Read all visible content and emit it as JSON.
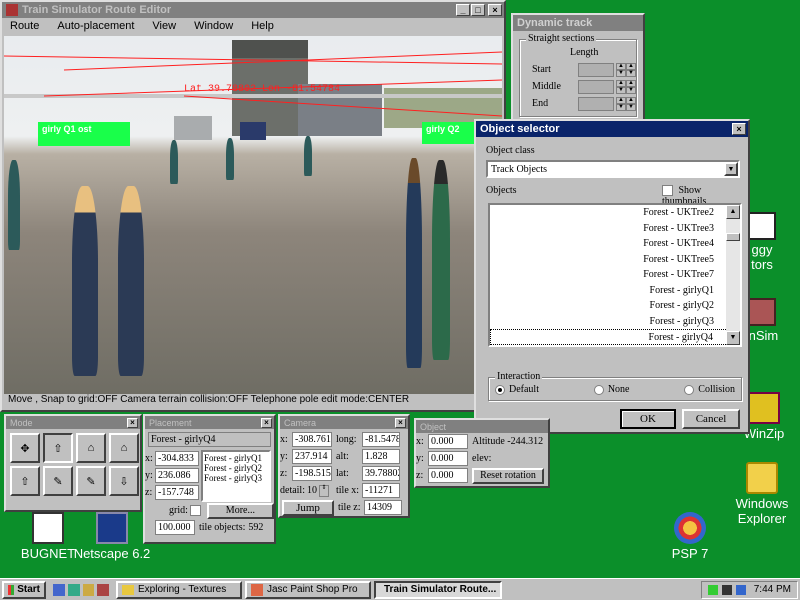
{
  "editor": {
    "title": "Train Simulator Route Editor",
    "menus": [
      "Route",
      "Auto-placement",
      "View",
      "Window",
      "Help"
    ],
    "hud_lat_lon": "Lat 39.78802 Lon -81.54784",
    "signs": [
      "girly Q1 ost",
      "girly Q2"
    ],
    "status": "Move , Snap to grid:OFF Camera terrain collision:OFF Telephone pole edit mode:CENTER"
  },
  "dynamic_track": {
    "title": "Dynamic track",
    "section_title": "Straight sections",
    "length_header": "Length",
    "rows": [
      "Start",
      "Middle",
      "End"
    ]
  },
  "object_selector": {
    "title": "Object selector",
    "class_label": "Object class",
    "class_value": "Track Objects",
    "objects_label": "Objects",
    "show_thumbnails_label": "Show thumbnails",
    "items": [
      "Forest - UKTree2",
      "Forest - UKTree3",
      "Forest - UKTree4",
      "Forest - UKTree5",
      "Forest - UKTree7",
      "Forest - girlyQ1",
      "Forest - girlyQ2",
      "Forest - girlyQ3",
      "Forest - girlyQ4"
    ],
    "selected_item": "Forest - girlyQ4",
    "interaction_label": "Interaction",
    "interaction_options": [
      "Default",
      "None",
      "Collision"
    ],
    "interaction_selected": "Default",
    "ok_label": "OK",
    "cancel_label": "Cancel"
  },
  "mode": {
    "title": "Mode"
  },
  "placement": {
    "title": "Placement",
    "current": "Forest - girlyQ4",
    "x": "-304.833",
    "y": "236.086",
    "z": "-157.748",
    "list": [
      "Forest - girlyQ1",
      "Forest - girlyQ2",
      "Forest - girlyQ3"
    ],
    "grid_label": "grid:",
    "more_label": "More...",
    "grid_value": "100.000",
    "tile_objects_label": "tile objects:",
    "tile_objects_value": "592",
    "x_label": "x:",
    "y_label": "y:",
    "z_label": "z:"
  },
  "camera": {
    "title": "Camera",
    "x": "-308.761",
    "y": "237.914",
    "z": "-198.515",
    "long": "-81.5478",
    "alt": "1.828",
    "lat": "39.78802",
    "tile_x": "-11271",
    "tile_z": "14309",
    "detail": "10",
    "jump_label": "Jump",
    "labels": {
      "x": "x:",
      "y": "y:",
      "z": "z:",
      "long": "long:",
      "alt": "alt:",
      "lat": "lat:",
      "detail": "detail:",
      "tile_x": "tile x:",
      "tile_z": "tile z:"
    }
  },
  "object_win": {
    "title": "Object",
    "x": "0.000",
    "y": "0.000",
    "z": "0.000",
    "altitude": "Altitude -244.312",
    "elev_label": "elev:",
    "reset_label": "Reset rotation",
    "labels": {
      "x": "x:",
      "y": "y:",
      "z": "z:"
    }
  },
  "desktop": {
    "icons": [
      {
        "label": "BUGNET"
      },
      {
        "label": "Netscape 6.2"
      },
      {
        "label": "PSP 7"
      },
      {
        "label": "WinZip"
      },
      {
        "label": "Windows Explorer"
      },
      {
        "label": "inSim"
      },
      {
        "label": "ggy"
      },
      {
        "label": "tors"
      }
    ]
  },
  "taskbar": {
    "start_label": "Start",
    "tasks": [
      "Exploring - Textures",
      "Jasc Paint Shop Pro",
      "Train Simulator Route..."
    ],
    "active_task": "Train Simulator Route...",
    "clock": "7:44 PM"
  },
  "colors": {
    "desktop": "#0b8f2a",
    "title_active": "#0a246a",
    "title_inactive": "#808080",
    "sign_green": "#19ff4a",
    "hud_red": "#ff2020"
  }
}
